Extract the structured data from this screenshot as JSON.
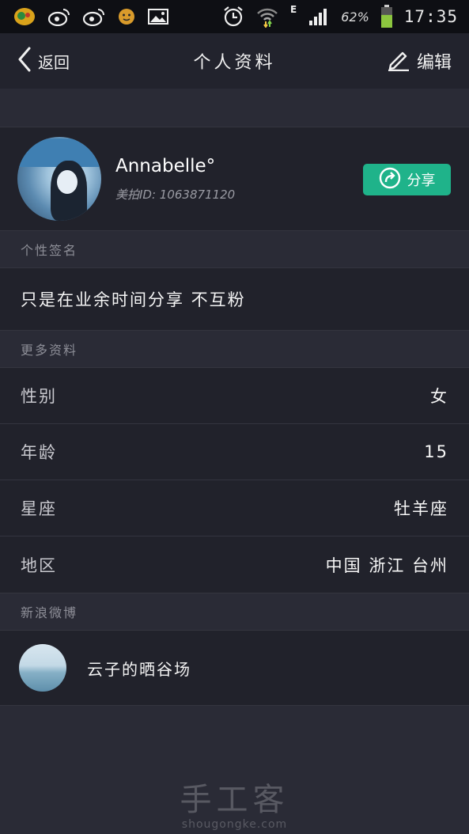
{
  "status_bar": {
    "left_icons": [
      "app-icon",
      "weibo-icon",
      "weibo-icon",
      "emoji-icon",
      "image-icon"
    ],
    "network_type": "E",
    "battery_percent": "62%",
    "battery_level": 0.62,
    "time": "17:35"
  },
  "nav": {
    "back_label": "返回",
    "title": "个人资料",
    "edit_label": "编辑"
  },
  "profile": {
    "name": "Annabelle°",
    "id_text": "美拍ID: 1063871120",
    "share_label": "分享"
  },
  "signature_section": {
    "header": "个性签名",
    "text": "只是在业余时间分享 不互粉"
  },
  "more_info": {
    "header": "更多资料",
    "rows": [
      {
        "label": "性别",
        "value": "女"
      },
      {
        "label": "年龄",
        "value": "15"
      },
      {
        "label": "星座",
        "value": "牡羊座"
      },
      {
        "label": "地区",
        "value": "中国 浙江 台州"
      }
    ]
  },
  "weibo": {
    "header": "新浪微博",
    "name": "云子的晒谷场"
  },
  "watermark": {
    "main": "手工客",
    "sub": "shougongke.com"
  },
  "colors": {
    "accent": "#1fb38a",
    "background": "#2a2b36",
    "card": "#21222b"
  }
}
